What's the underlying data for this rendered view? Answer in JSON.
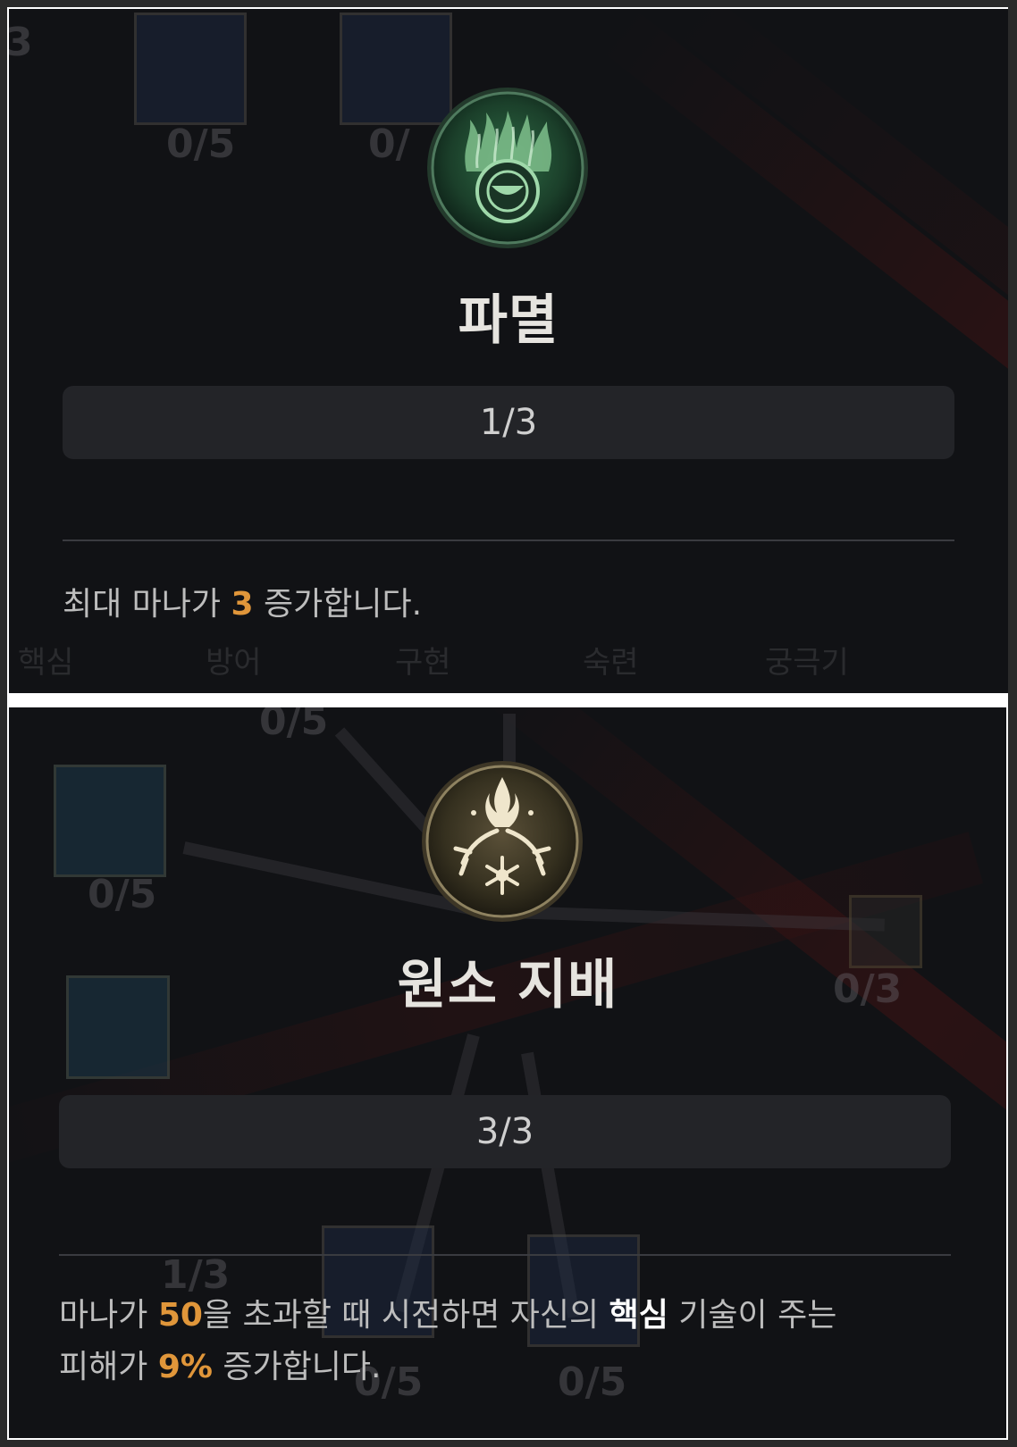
{
  "tooltips": [
    {
      "title": "파멸",
      "rank": "1/3",
      "description": {
        "before": "최대 마나가 ",
        "num": "3",
        "after": " 증가합니다."
      },
      "icon": "green-flame-chalice-icon",
      "accent": "#2f7a4a"
    },
    {
      "title": "원소 지배",
      "rank": "3/3",
      "description": {
        "line1_a": "마나가 ",
        "line1_num": "50",
        "line1_b": "을 초과할 때 시전하면 자신의 ",
        "line1_key": "핵심",
        "line1_c": " 기술이 주는",
        "line2_a": "피해가 ",
        "line2_num": "9%",
        "line2_b": " 증가합니다."
      },
      "icon": "elemental-fire-frost-icon",
      "accent": "#8a7a4a"
    }
  ],
  "background": {
    "top_counts": [
      "0/5",
      "0/"
    ],
    "top_corner": "3",
    "tabs": [
      "핵심",
      "방어",
      "구현",
      "숙련",
      "궁극기"
    ],
    "bottom_counts": [
      "0/5",
      "0/5",
      "0/3",
      "1/3",
      "0/5",
      "0/5"
    ]
  },
  "colors": {
    "highlight_number": "#e0963a",
    "panel_bg": "#111215",
    "rank_bar_bg": "#232428"
  }
}
